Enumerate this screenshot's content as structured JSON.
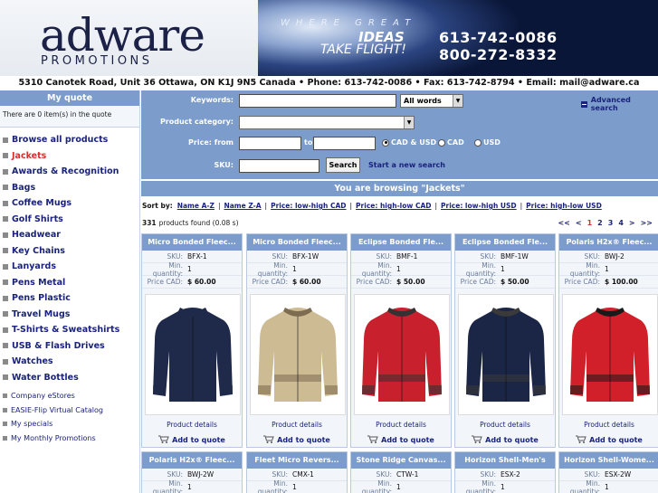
{
  "header": {
    "logo_word": "adware",
    "logo_sub": "PROMOTIONS",
    "tagline": "WHERE GREAT",
    "ideas": "IDEAS",
    "take_flight": "TAKE FLIGHT!",
    "phone1": "613-742-0086",
    "phone2": "800-272-8332"
  },
  "address": "5310 Canotek Road, Unit 36 Ottawa, ON K1J 9N5 Canada • Phone: 613-742-0086 • Fax: 613-742-8794 • Email: mail@adware.ca",
  "sidebar": {
    "quote_title": "My quote",
    "quote_text": "There are 0 item(s) in the quote",
    "categories": [
      {
        "label": "Browse all products",
        "active": false
      },
      {
        "label": "Jackets",
        "active": true
      },
      {
        "label": "Awards & Recognition",
        "active": false
      },
      {
        "label": "Bags",
        "active": false
      },
      {
        "label": "Coffee Mugs",
        "active": false
      },
      {
        "label": "Golf Shirts",
        "active": false
      },
      {
        "label": "Headwear",
        "active": false
      },
      {
        "label": "Key Chains",
        "active": false
      },
      {
        "label": "Lanyards",
        "active": false
      },
      {
        "label": "Pens Metal",
        "active": false
      },
      {
        "label": "Pens Plastic",
        "active": false
      },
      {
        "label": "Travel Mugs",
        "active": false
      },
      {
        "label": "T-Shirts & Sweatshirts",
        "active": false
      },
      {
        "label": "USB & Flash Drives",
        "active": false
      },
      {
        "label": "Watches",
        "active": false
      },
      {
        "label": "Water Bottles",
        "active": false
      }
    ],
    "extras": [
      "Company eStores",
      "EASIE-Flip Virtual Catalog",
      "My specials",
      "My Monthly Promotions"
    ]
  },
  "search": {
    "keywords_label": "Keywords:",
    "keywords_value": "",
    "match_option": "All words",
    "category_label": "Product category:",
    "category_value": "",
    "price_label": "Price: from",
    "to_label": "to",
    "price_from": "",
    "price_to": "",
    "currency_options": [
      {
        "label": "CAD & USD",
        "selected": true
      },
      {
        "label": "CAD",
        "selected": false
      },
      {
        "label": "USD",
        "selected": false
      }
    ],
    "sku_label": "SKU:",
    "sku_value": "",
    "search_button": "Search",
    "new_search": "Start a new search",
    "advanced": "Advanced search"
  },
  "browsing": "You are browsing \"Jackets\"",
  "sort": {
    "label": "Sort by:",
    "options": [
      "Name A-Z",
      "Name Z-A",
      "Price: low-high CAD",
      "Price: high-low CAD",
      "Price: low-high USD",
      "Price: high-low USD"
    ]
  },
  "results": {
    "count": "331",
    "text": "products found (0.08 s)"
  },
  "pager": {
    "first": "<<",
    "prev": "<",
    "pages": [
      "1",
      "2",
      "3",
      "4"
    ],
    "current": "1",
    "next": ">",
    "last": ">>"
  },
  "labels": {
    "sku": "SKU:",
    "min_qty": "Min. quantity:",
    "price_cad": "Price CAD:",
    "details": "Product details",
    "add": "Add to quote"
  },
  "products": [
    {
      "title": "Micro Bonded Fleec...",
      "sku": "BFX-1",
      "min_qty": "1",
      "price": "$ 60.00",
      "jacket_color": "#1f2a4a",
      "trim_color": "#1f2a4a"
    },
    {
      "title": "Micro Bonded Fleec...",
      "sku": "BFX-1W",
      "min_qty": "1",
      "price": "$ 60.00",
      "jacket_color": "#cdbb94",
      "trim_color": "#7e6c50"
    },
    {
      "title": "Eclipse Bonded Fle...",
      "sku": "BMF-1",
      "min_qty": "1",
      "price": "$ 50.00",
      "jacket_color": "#c8202d",
      "trim_color": "#333333"
    },
    {
      "title": "Eclipse Bonded Fle...",
      "sku": "BMF-1W",
      "min_qty": "1",
      "price": "$ 50.00",
      "jacket_color": "#1b2545",
      "trim_color": "#3a3a3a"
    },
    {
      "title": "Polaris H2x® Fleec...",
      "sku": "BWJ-2",
      "min_qty": "1",
      "price": "$ 100.00",
      "jacket_color": "#d2202a",
      "trim_color": "#1a1a1a"
    },
    {
      "title": "Polaris H2x® Fleec...",
      "sku": "BWJ-2W",
      "min_qty": "1"
    },
    {
      "title": "Fleet Micro Revers...",
      "sku": "CMX-1",
      "min_qty": "1"
    },
    {
      "title": "Stone Ridge Canvas...",
      "sku": "CTW-1",
      "min_qty": "1"
    },
    {
      "title": "Horizon Shell-Men's",
      "sku": "ESX-2",
      "min_qty": "1"
    },
    {
      "title": "Horizon Shell-Wome...",
      "sku": "ESX-2W",
      "min_qty": "1"
    }
  ]
}
